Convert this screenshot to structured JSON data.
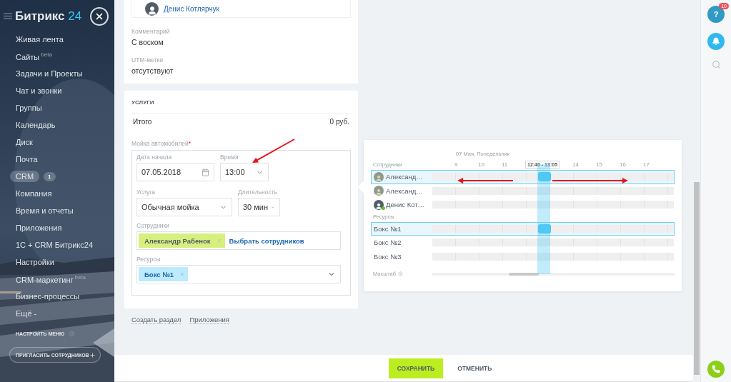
{
  "sidebar": {
    "logo": {
      "name": "Битрикс",
      "number": "24"
    },
    "items": [
      {
        "label": "Живая лента",
        "selected": false
      },
      {
        "label": "Сайты",
        "sup": "beta",
        "selected": false
      },
      {
        "label": "Задачи и Проекты",
        "selected": false
      },
      {
        "label": "Чат и звонки",
        "selected": false
      },
      {
        "label": "Группы",
        "selected": false
      },
      {
        "label": "Календарь",
        "selected": false
      },
      {
        "label": "Диск",
        "selected": false
      },
      {
        "label": "Почта",
        "selected": false
      },
      {
        "label": "CRM",
        "counter": "1",
        "selected": true
      },
      {
        "label": "Компания",
        "selected": false
      },
      {
        "label": "Время и отчеты",
        "selected": false
      },
      {
        "label": "Приложения",
        "selected": false
      },
      {
        "label": "1С + CRM Битрикс24",
        "selected": false
      },
      {
        "label": "Настройки",
        "selected": false
      },
      {
        "label": "CRM-маркетинг",
        "sup": "beta",
        "selected": false
      },
      {
        "label": "Бизнес-процессы",
        "selected": false
      },
      {
        "label": "Ещё -",
        "selected": false
      }
    ],
    "settings": "НАСТРОИТЬ МЕНЮ",
    "invite": "ПРИГЛАСИТЬ СОТРУДНИКОВ"
  },
  "deal": {
    "responsible": "Денис Котлярчук",
    "fields": [
      {
        "label": "Комментарий",
        "value": "С воском"
      },
      {
        "label": "UTM-метки",
        "value": "отсутствуют"
      }
    ]
  },
  "services": {
    "title": "УСЛУГИ",
    "total_label": "Итого",
    "total_value": "0 руб.",
    "booking": {
      "label": "Мойка автомобилей",
      "required_mark": "*",
      "start_date": {
        "label": "Дата начала",
        "value": "07.05.2018"
      },
      "time": {
        "label": "Время",
        "value": "13:00"
      },
      "service": {
        "label": "Услуга",
        "value": "Обычная мойка"
      },
      "duration": {
        "label": "Длительность",
        "value": "30 мин"
      },
      "staff": {
        "label": "Сотрудники",
        "tags": [
          "Александр Рабенок"
        ],
        "add_link": "Выбрать сотрудников"
      },
      "resources": {
        "label": "Ресурсы",
        "tags": [
          "Бокс №1"
        ]
      }
    }
  },
  "links": [
    "Создать раздел",
    "Приложения"
  ],
  "timeline": {
    "date": "07 Мая, Понедельник",
    "hours_before": [
      "9",
      "10",
      "11"
    ],
    "selection": "12:40 - 13:05",
    "hours_after": [
      "14",
      "15",
      "16",
      "17"
    ],
    "staff_label": "Сотрудники",
    "staff": [
      {
        "name": "Александ…",
        "has_photo": true,
        "online": false,
        "selected": true
      },
      {
        "name": "Александ…",
        "has_photo": true,
        "online": false,
        "selected": false
      },
      {
        "name": "Денис Кот…",
        "has_photo": false,
        "online": true,
        "selected": false
      }
    ],
    "resources_label": "Ресурсы",
    "resources": [
      {
        "name": "Бокс №1",
        "selected": true
      },
      {
        "name": "Бокс №2",
        "selected": false
      },
      {
        "name": "Бокс №3",
        "selected": false
      }
    ],
    "scale_label": "Масштаб"
  },
  "right_panel": {
    "help_label": "?",
    "help_badge": "10"
  },
  "footer": {
    "buttons": [
      {
        "label": "СОХРАНИТЬ",
        "kind": "primary"
      },
      {
        "label": "ОТМЕНИТЬ",
        "kind": "plain"
      }
    ]
  }
}
